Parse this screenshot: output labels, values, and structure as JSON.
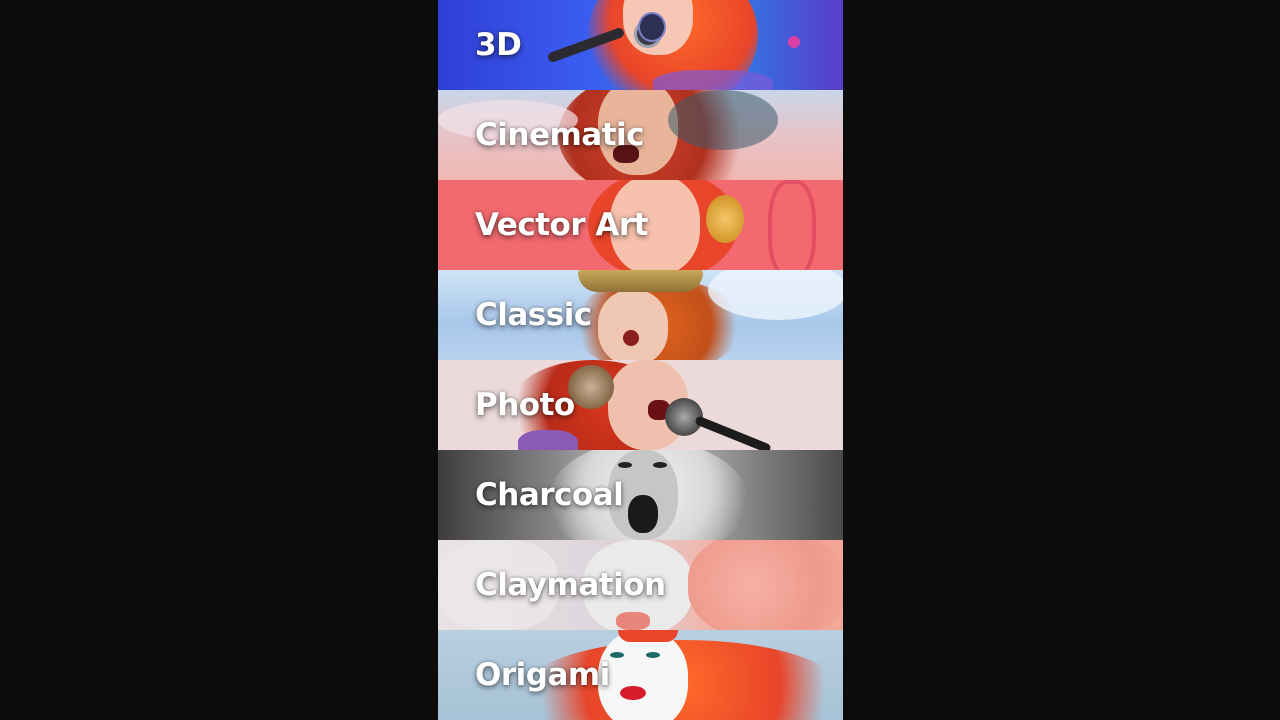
{
  "styles": [
    {
      "id": "3d",
      "label": "3D"
    },
    {
      "id": "cinematic",
      "label": "Cinematic"
    },
    {
      "id": "vector",
      "label": "Vector Art"
    },
    {
      "id": "classic",
      "label": "Classic"
    },
    {
      "id": "photo",
      "label": "Photo"
    },
    {
      "id": "charcoal",
      "label": "Charcoal"
    },
    {
      "id": "clay",
      "label": "Claymation"
    },
    {
      "id": "origami",
      "label": "Origami"
    }
  ],
  "colors": {
    "page_background": "#0c0c0d",
    "label_text": "#ffffff",
    "hair_red": "#e8452a"
  }
}
